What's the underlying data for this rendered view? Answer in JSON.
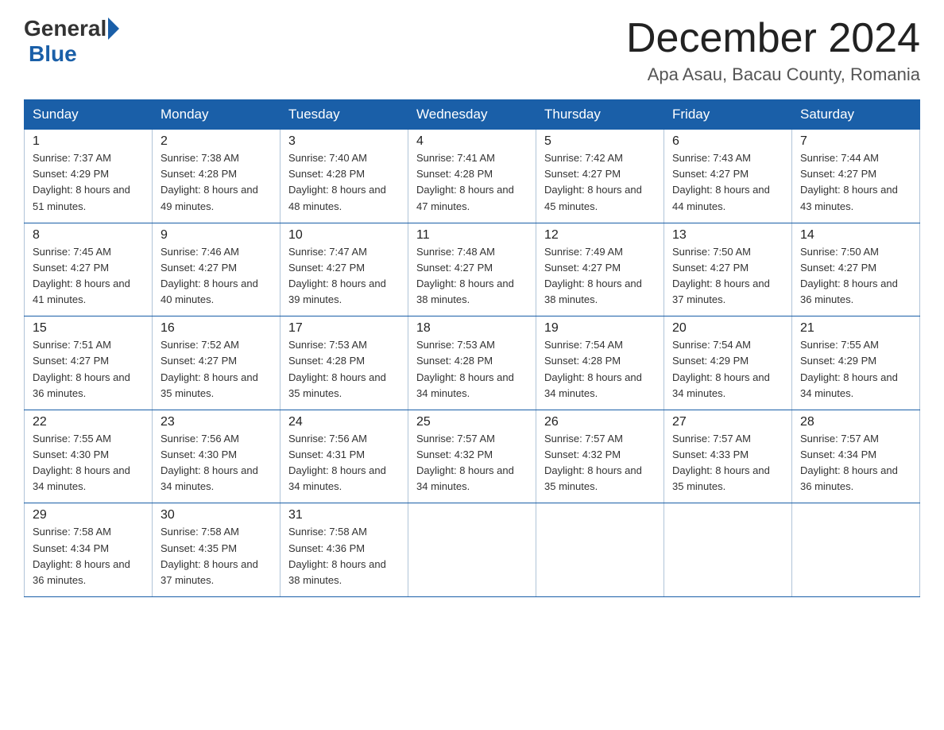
{
  "header": {
    "logo_text_general": "General",
    "logo_text_blue": "Blue",
    "month_title": "December 2024",
    "location": "Apa Asau, Bacau County, Romania"
  },
  "weekdays": [
    "Sunday",
    "Monday",
    "Tuesday",
    "Wednesday",
    "Thursday",
    "Friday",
    "Saturday"
  ],
  "weeks": [
    [
      {
        "day": "1",
        "sunrise": "7:37 AM",
        "sunset": "4:29 PM",
        "daylight": "8 hours and 51 minutes."
      },
      {
        "day": "2",
        "sunrise": "7:38 AM",
        "sunset": "4:28 PM",
        "daylight": "8 hours and 49 minutes."
      },
      {
        "day": "3",
        "sunrise": "7:40 AM",
        "sunset": "4:28 PM",
        "daylight": "8 hours and 48 minutes."
      },
      {
        "day": "4",
        "sunrise": "7:41 AM",
        "sunset": "4:28 PM",
        "daylight": "8 hours and 47 minutes."
      },
      {
        "day": "5",
        "sunrise": "7:42 AM",
        "sunset": "4:27 PM",
        "daylight": "8 hours and 45 minutes."
      },
      {
        "day": "6",
        "sunrise": "7:43 AM",
        "sunset": "4:27 PM",
        "daylight": "8 hours and 44 minutes."
      },
      {
        "day": "7",
        "sunrise": "7:44 AM",
        "sunset": "4:27 PM",
        "daylight": "8 hours and 43 minutes."
      }
    ],
    [
      {
        "day": "8",
        "sunrise": "7:45 AM",
        "sunset": "4:27 PM",
        "daylight": "8 hours and 41 minutes."
      },
      {
        "day": "9",
        "sunrise": "7:46 AM",
        "sunset": "4:27 PM",
        "daylight": "8 hours and 40 minutes."
      },
      {
        "day": "10",
        "sunrise": "7:47 AM",
        "sunset": "4:27 PM",
        "daylight": "8 hours and 39 minutes."
      },
      {
        "day": "11",
        "sunrise": "7:48 AM",
        "sunset": "4:27 PM",
        "daylight": "8 hours and 38 minutes."
      },
      {
        "day": "12",
        "sunrise": "7:49 AM",
        "sunset": "4:27 PM",
        "daylight": "8 hours and 38 minutes."
      },
      {
        "day": "13",
        "sunrise": "7:50 AM",
        "sunset": "4:27 PM",
        "daylight": "8 hours and 37 minutes."
      },
      {
        "day": "14",
        "sunrise": "7:50 AM",
        "sunset": "4:27 PM",
        "daylight": "8 hours and 36 minutes."
      }
    ],
    [
      {
        "day": "15",
        "sunrise": "7:51 AM",
        "sunset": "4:27 PM",
        "daylight": "8 hours and 36 minutes."
      },
      {
        "day": "16",
        "sunrise": "7:52 AM",
        "sunset": "4:27 PM",
        "daylight": "8 hours and 35 minutes."
      },
      {
        "day": "17",
        "sunrise": "7:53 AM",
        "sunset": "4:28 PM",
        "daylight": "8 hours and 35 minutes."
      },
      {
        "day": "18",
        "sunrise": "7:53 AM",
        "sunset": "4:28 PM",
        "daylight": "8 hours and 34 minutes."
      },
      {
        "day": "19",
        "sunrise": "7:54 AM",
        "sunset": "4:28 PM",
        "daylight": "8 hours and 34 minutes."
      },
      {
        "day": "20",
        "sunrise": "7:54 AM",
        "sunset": "4:29 PM",
        "daylight": "8 hours and 34 minutes."
      },
      {
        "day": "21",
        "sunrise": "7:55 AM",
        "sunset": "4:29 PM",
        "daylight": "8 hours and 34 minutes."
      }
    ],
    [
      {
        "day": "22",
        "sunrise": "7:55 AM",
        "sunset": "4:30 PM",
        "daylight": "8 hours and 34 minutes."
      },
      {
        "day": "23",
        "sunrise": "7:56 AM",
        "sunset": "4:30 PM",
        "daylight": "8 hours and 34 minutes."
      },
      {
        "day": "24",
        "sunrise": "7:56 AM",
        "sunset": "4:31 PM",
        "daylight": "8 hours and 34 minutes."
      },
      {
        "day": "25",
        "sunrise": "7:57 AM",
        "sunset": "4:32 PM",
        "daylight": "8 hours and 34 minutes."
      },
      {
        "day": "26",
        "sunrise": "7:57 AM",
        "sunset": "4:32 PM",
        "daylight": "8 hours and 35 minutes."
      },
      {
        "day": "27",
        "sunrise": "7:57 AM",
        "sunset": "4:33 PM",
        "daylight": "8 hours and 35 minutes."
      },
      {
        "day": "28",
        "sunrise": "7:57 AM",
        "sunset": "4:34 PM",
        "daylight": "8 hours and 36 minutes."
      }
    ],
    [
      {
        "day": "29",
        "sunrise": "7:58 AM",
        "sunset": "4:34 PM",
        "daylight": "8 hours and 36 minutes."
      },
      {
        "day": "30",
        "sunrise": "7:58 AM",
        "sunset": "4:35 PM",
        "daylight": "8 hours and 37 minutes."
      },
      {
        "day": "31",
        "sunrise": "7:58 AM",
        "sunset": "4:36 PM",
        "daylight": "8 hours and 38 minutes."
      },
      null,
      null,
      null,
      null
    ]
  ]
}
